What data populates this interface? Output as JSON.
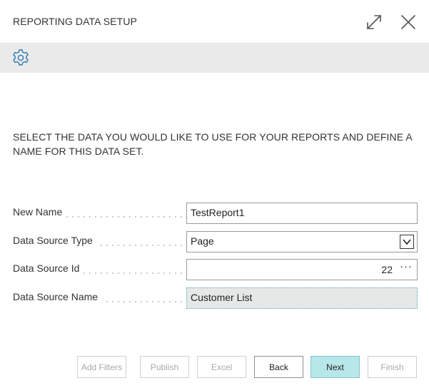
{
  "window": {
    "title": "REPORTING DATA SETUP",
    "expand_icon": "expand-icon",
    "close_icon": "close-icon"
  },
  "toolbar": {
    "settings_icon": "gear-icon"
  },
  "instructions": "SELECT THE DATA YOU WOULD LIKE TO USE FOR YOUR REPORTS AND DEFINE A NAME FOR THIS DATA SET.",
  "fields": {
    "new_name": {
      "label": "New Name",
      "value": "TestReport1"
    },
    "data_source_type": {
      "label": "Data Source Type",
      "value": "Page"
    },
    "data_source_id": {
      "label": "Data Source Id",
      "value": "22",
      "lookup": "···"
    },
    "data_source_name": {
      "label": "Data Source Name",
      "value": "Customer List"
    }
  },
  "buttons": {
    "add_filters": "Add Filters",
    "publish": "Publish",
    "excel": "Excel",
    "back": "Back",
    "next": "Next",
    "finish": "Finish"
  },
  "colors": {
    "toolbar_bg": "#eaeaea",
    "accent": "#2a7ab0",
    "primary_button": "#b8e7ea"
  }
}
